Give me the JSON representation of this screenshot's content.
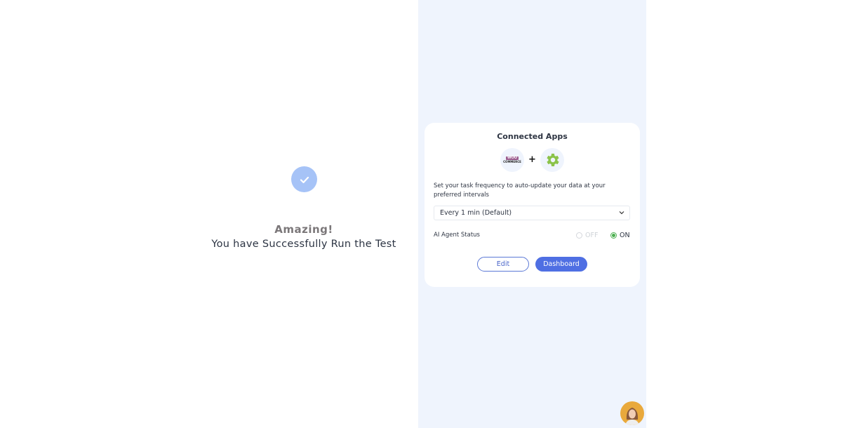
{
  "success": {
    "icon": "check-circle-icon",
    "heading": "Amazing!",
    "message": "You have Successfully Run the Test"
  },
  "card": {
    "title": "Connected Apps",
    "apps": [
      {
        "name": "woocommerce-logo",
        "label_top": "WOO",
        "label_bottom": "COMMERCE"
      },
      {
        "name": "settings-gear-logo"
      }
    ],
    "plus": "+",
    "description": "Set your task frequency to auto-update your data at your preferred intervals",
    "frequency": {
      "selected": "Every 1 min (Default)"
    },
    "agent_status": {
      "label": "AI Agent Status",
      "options": [
        {
          "label": "OFF",
          "selected": false
        },
        {
          "label": "ON",
          "selected": true
        }
      ]
    },
    "buttons": {
      "edit": "Edit",
      "dashboard": "Dashboard"
    }
  },
  "colors": {
    "accent": "#4f6fe3",
    "success_green": "#4caf50",
    "gear_green": "#8bc34a",
    "panel_bg": "#eff4fd"
  }
}
